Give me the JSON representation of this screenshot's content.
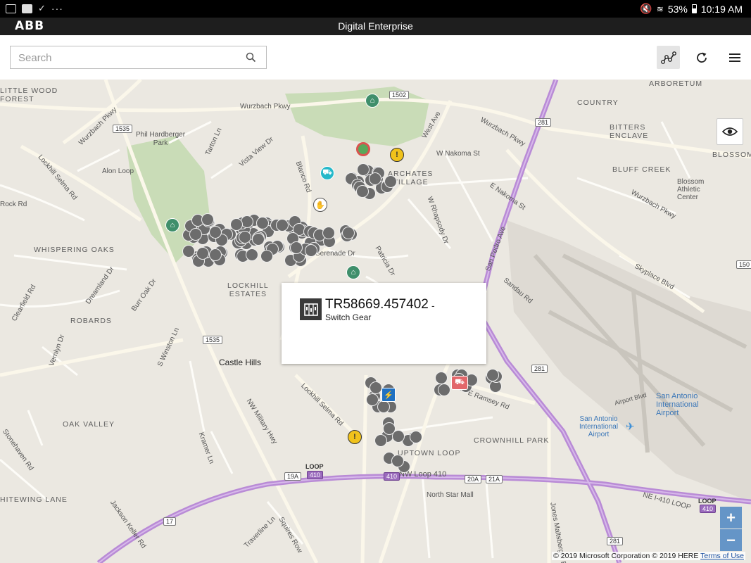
{
  "status_bar": {
    "battery": "53%",
    "time": "10:19 AM"
  },
  "app": {
    "logo": "ABB",
    "title": "Digital Enterprise"
  },
  "toolbar": {
    "search_placeholder": "Search",
    "icons": [
      "search-icon",
      "network-icon",
      "refresh-icon",
      "menu-icon"
    ]
  },
  "map": {
    "labels": {
      "white_wood_forest": "LITTLE WOOD\nFOREST",
      "arboretum": "ARBORETUM",
      "country": "COUNTRY",
      "bitters_enclave": "BITTERS\nENCLAVE",
      "bluff_creek": "BLUFF CREEK",
      "blossom_athletic": "Blossom\nAthletic\nCenter",
      "blossom": "BLOSSOM",
      "phil_hardberger": "Phil Hardberger\nPark",
      "whispering_oaks": "WHISPERING OAKS",
      "lockhill_estates": "LOCKHILL\nESTATES",
      "robards": "ROBARDS",
      "castle_hills": "Castle Hills",
      "oak_valley": "OAK VALLEY",
      "crownhill_park": "CROWNHILL PARK",
      "uptown_loop": "UPTOWN LOOP",
      "north_star_mall": "North Star Mall",
      "jackson_keller": "Jackson Keller Rd",
      "whitewing_lane": "HITEWING LANE",
      "sa_intl_airport_big": "San Antonio\nInternational\nAirport",
      "sa_intl_airport_small": "San Antonio\nInternational\nAirport",
      "archates_village": "ARCHATES\nVILLAGE",
      "wurzbach_pkwy_top": "Wurzbach Pkwy",
      "wurzbach_pkwy_left": "Wurzbach Pkwy",
      "wurzbach_pkwy_right": "Wurzbach Pkwy",
      "wurzbach_rd": "Wurzbach Pkwy",
      "lockhill_selma": "Lockhill Selma Rd",
      "lockhill_selma_2": "Lockhill Selma Rd",
      "blanco_rd": "Blanco Rd",
      "west_ave": "West Ave",
      "w_nakoma": "W Nakoma St",
      "e_nakoma": "E Nakoma St",
      "san_pedro": "San Pedro Ave",
      "nw_military": "NW Military Hwy",
      "nw_loop_410": "NW Loop 410",
      "ne_loop_410": "NE I-410 LOOP",
      "sandau": "Sandau Rd",
      "skyplace": "Skyplace Blvd",
      "airport_blvd": "Airport Blvd",
      "e_ramsey": "E Ramsey Rd",
      "dreamland": "Dreamland Dr",
      "burr_oak": "Burr Oak Dr",
      "serenade": "Serenade Dr",
      "patricia": "Patricia Dr",
      "rhapsody": "W Rhapsody Dr",
      "s_winston": "S Winston Ln",
      "clearfield": "Clearfield Rd",
      "vernlyn": "Vernlyn Dr",
      "stonehaven": "Stonehaven Rd",
      "kramer": "Kramer Ln",
      "squires": "Squires Row",
      "jones_maltsberger": "Jones Maltsberger Rd",
      "traverline": "Traverline Ln",
      "vista_view": "Vista View Dr",
      "tarton": "Tarton Ln",
      "alon_loop": "Alon Loop",
      "rock_rd": "Rock Rd",
      "loop_label_1": "LOOP",
      "loop_label_2": "LOOP"
    },
    "shields": {
      "s1502": "1502",
      "s1535a": "1535",
      "s1535b": "1535",
      "s281a": "281",
      "s281b": "281",
      "s281c": "281",
      "s410a": "410",
      "s410b": "410",
      "s410c": "410",
      "s19a": "19A",
      "s20a": "20A",
      "s21a": "21A",
      "s17": "17",
      "s150": "150"
    },
    "popup": {
      "id": "TR58669.457402",
      "dash": "-",
      "type": "Switch Gear"
    },
    "zoom_in": "+",
    "zoom_out": "−",
    "attribution": {
      "text": "© 2019 Microsoft Corporation © 2019 HERE",
      "link": "Terms of Use"
    }
  }
}
